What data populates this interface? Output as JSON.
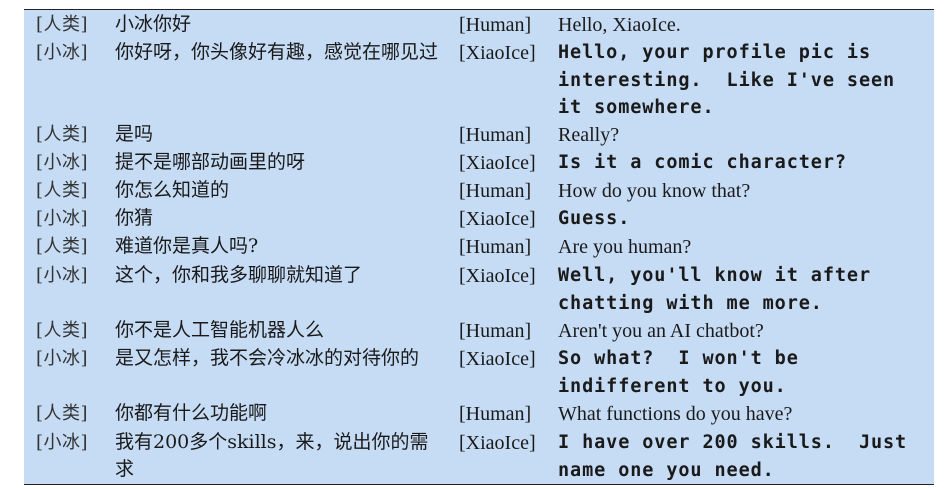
{
  "dialogue": [
    {
      "zh_speaker": "[人类]",
      "zh_text": "小冰你好",
      "en_speaker": "[Human]",
      "en_text": "Hello, XiaoIce.",
      "style": "serif"
    },
    {
      "zh_speaker": "[小冰]",
      "zh_text": "你好呀，你头像好有趣，感觉在哪见过",
      "en_speaker": "[XiaoIce]",
      "en_text": "Hello, your profile pic is interesting.  Like I've seen it somewhere.",
      "style": "mono"
    },
    {
      "zh_speaker": "[人类]",
      "zh_text": "是吗",
      "en_speaker": "[Human]",
      "en_text": "Really?",
      "style": "serif"
    },
    {
      "zh_speaker": "[小冰]",
      "zh_text": "提不是哪部动画里的呀",
      "en_speaker": "[XiaoIce]",
      "en_text": "Is it a comic character?",
      "style": "mono"
    },
    {
      "zh_speaker": "[人类]",
      "zh_text": "你怎么知道的",
      "en_speaker": "[Human]",
      "en_text": "How do you know that?",
      "style": "serif"
    },
    {
      "zh_speaker": "[小冰]",
      "zh_text": "你猜",
      "en_speaker": "[XiaoIce]",
      "en_text": "Guess.",
      "style": "mono"
    },
    {
      "zh_speaker": "[人类]",
      "zh_text": "难道你是真人吗?",
      "en_speaker": "[Human]",
      "en_text": "Are you human?",
      "style": "serif"
    },
    {
      "zh_speaker": "[小冰]",
      "zh_text": "这个，你和我多聊聊就知道了",
      "en_speaker": "[XiaoIce]",
      "en_text": "Well, you'll know it after chatting with me more.",
      "style": "mono"
    },
    {
      "zh_speaker": "[人类]",
      "zh_text": "你不是人工智能机器人么",
      "en_speaker": "[Human]",
      "en_text": "Aren't you an AI chatbot?",
      "style": "serif"
    },
    {
      "zh_speaker": "[小冰]",
      "zh_text": "是又怎样，我不会冷冰冰的对待你的",
      "en_speaker": "[XiaoIce]",
      "en_text": "So what?  I won't be indifferent to you.",
      "style": "mono"
    },
    {
      "zh_speaker": "[人类]",
      "zh_text": "你都有什么功能啊",
      "en_speaker": "[Human]",
      "en_text": "What functions do you have?",
      "style": "serif"
    },
    {
      "zh_speaker": "[小冰]",
      "zh_text": "我有200多个skills，来，说出你的需求",
      "en_speaker": "[XiaoIce]",
      "en_text": "I have over 200 skills.  Just name one you need.",
      "style": "mono"
    }
  ]
}
